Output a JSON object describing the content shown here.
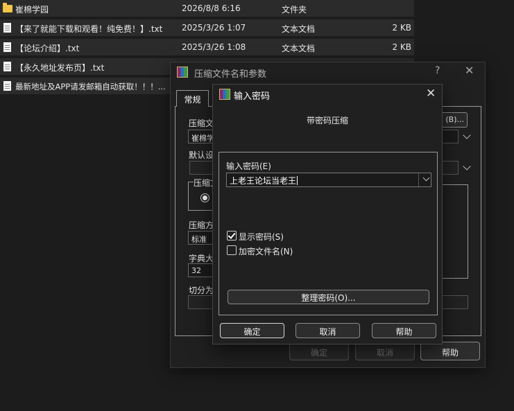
{
  "files": [
    {
      "name": "崔棉学园",
      "date": "2026/8/8 6:16",
      "type": "文件夹",
      "size": "",
      "icon": "folder-icon"
    },
    {
      "name": "【来了就能下载和观看！纯免费！】.txt",
      "date": "2025/3/26 1:07",
      "type": "文本文档",
      "size": "2 KB",
      "icon": "text-file-icon"
    },
    {
      "name": "【论坛介绍】.txt",
      "date": "2025/3/26 1:08",
      "type": "文本文档",
      "size": "2 KB",
      "icon": "text-file-icon"
    },
    {
      "name": "【永久地址发布页】.txt",
      "date": "",
      "type": "",
      "size": "",
      "icon": "text-file-icon"
    },
    {
      "name": "最新地址及APP请发邮箱自动获取！！！...",
      "date": "",
      "type": "",
      "size": "",
      "icon": "text-file-icon"
    }
  ],
  "archive_dialog": {
    "title": "压缩文件名和参数",
    "help_glyph": "?",
    "close_glyph": "✕",
    "tab_general": "常规",
    "label_archive_name": "压缩文",
    "archive_name_value": "崔棉学",
    "browse_label": "(B)...",
    "label_default": "默认设",
    "label_format": "压缩文",
    "label_method": "压缩方",
    "method_value": "标准",
    "label_dict": "字典大",
    "dict_value": "32",
    "label_split": "切分为",
    "ok_label": "确定",
    "cancel_label": "取消",
    "help_label": "帮助"
  },
  "password_dialog": {
    "title": "输入密码",
    "close_glyph": "✕",
    "subtitle": "带密码压缩",
    "password_label": "输入密码(E)",
    "password_value": "上老王论坛当老王",
    "show_password_label": "显示密码(S)",
    "show_password_checked": true,
    "encrypt_names_label": "加密文件名(N)",
    "encrypt_names_checked": false,
    "organize_label": "整理密码(O)...",
    "ok_label": "确定",
    "cancel_label": "取消",
    "help_label": "帮助"
  }
}
